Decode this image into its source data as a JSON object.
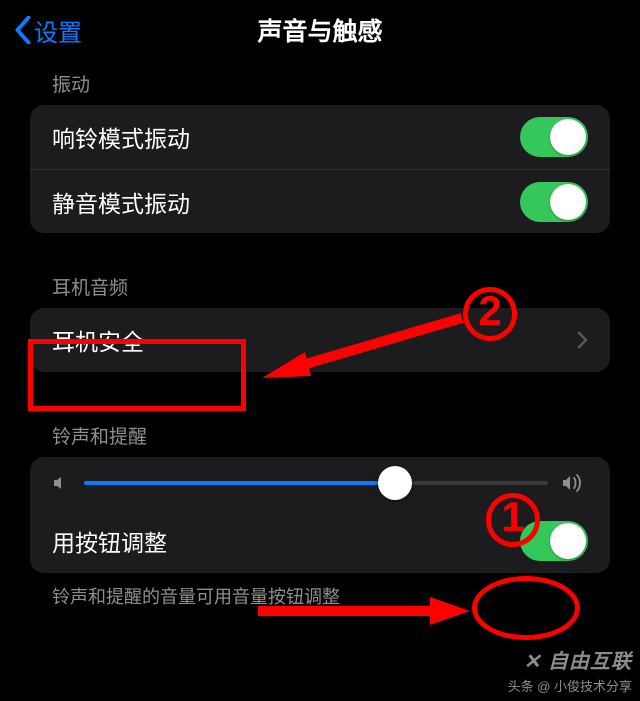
{
  "nav": {
    "back": "设置",
    "title": "声音与触感"
  },
  "section1": {
    "header": "振动",
    "row1": "响铃模式振动",
    "row2": "静音模式振动"
  },
  "section2": {
    "header": "耳机音频",
    "row1": "耳机安全"
  },
  "section3": {
    "header": "铃声和提醒",
    "row1": "用按钮调整",
    "footer": "铃声和提醒的音量可用音量按钮调整"
  },
  "anno": {
    "step1": "1",
    "step2": "2"
  },
  "watermark": {
    "logo": "✕ 自由互联",
    "sub": "头条 @ 小俊技术分享"
  }
}
